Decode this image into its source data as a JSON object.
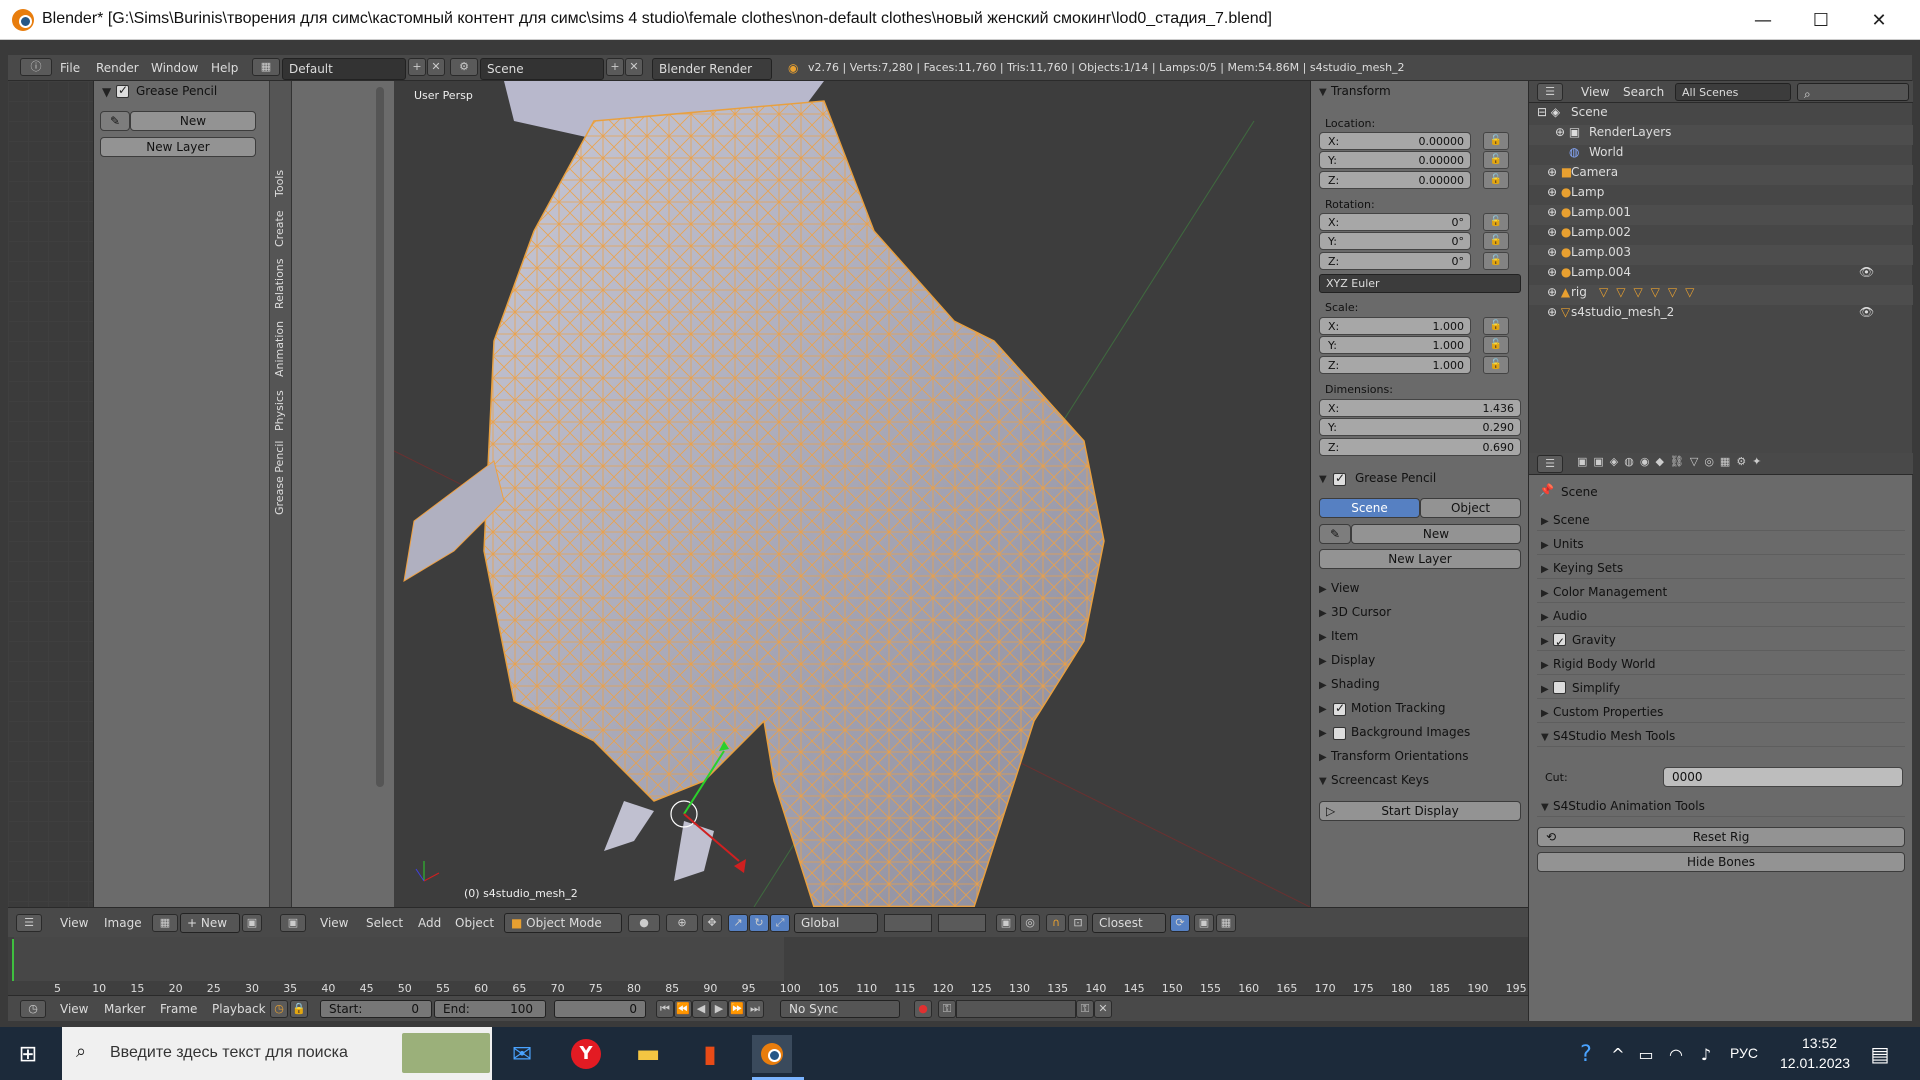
{
  "window": {
    "title": "Blender* [G:\\Sims\\Burinis\\творения для симс\\кастомный контент для симс\\sims 4 studio\\female clothes\\non-default clothes\\новый женский смокинг\\lod0_стадия_7.blend]",
    "minimize": "—",
    "maximize": "☐",
    "close": "✕"
  },
  "infobar": {
    "menus": [
      "File",
      "Render",
      "Window",
      "Help"
    ],
    "layout": "Default",
    "scene": "Scene",
    "engine": "Blender Render",
    "stats": "v2.76 | Verts:7,280 | Faces:11,760 | Tris:11,760 | Objects:1/14 | Lamps:0/5 | Mem:54.86M | s4studio_mesh_2"
  },
  "left_panel": {
    "title": "Grease Pencil",
    "new_button": "New",
    "new_layer_button": "New Layer"
  },
  "tool_tabs": [
    "Tools",
    "Create",
    "Relations",
    "Animation",
    "Physics",
    "Grease Pencil"
  ],
  "viewport": {
    "view_label": "User Persp",
    "object_label": "(0) s4studio_mesh_2"
  },
  "npanel": {
    "transform_title": "Transform",
    "location_label": "Location:",
    "location": {
      "x": "0.00000",
      "y": "0.00000",
      "z": "0.00000"
    },
    "rotation_label": "Rotation:",
    "rotation": {
      "x": "0°",
      "y": "0°",
      "z": "0°"
    },
    "rotation_mode": "XYZ Euler",
    "scale_label": "Scale:",
    "scale": {
      "x": "1.000",
      "y": "1.000",
      "z": "1.000"
    },
    "dimensions_label": "Dimensions:",
    "dimensions": {
      "x": "1.436",
      "y": "0.290",
      "z": "0.690"
    },
    "axis": {
      "x": "X:",
      "y": "Y:",
      "z": "Z:"
    },
    "grease_title": "Grease Pencil",
    "scene_tab": "Scene",
    "object_tab": "Object",
    "new_button": "New",
    "new_layer_button": "New Layer",
    "sections": [
      "View",
      "3D Cursor",
      "Item",
      "Display",
      "Shading",
      "Motion Tracking",
      "Background Images",
      "Transform Orientations",
      "Screencast Keys"
    ],
    "start_display": "Start Display"
  },
  "outliner": {
    "menus": [
      "View",
      "Search"
    ],
    "filter": "All Scenes",
    "rows": [
      "Scene",
      "RenderLayers",
      "World",
      "Camera",
      "Lamp",
      "Lamp.001",
      "Lamp.002",
      "Lamp.003",
      "Lamp.004",
      "rig",
      "s4studio_mesh_2"
    ]
  },
  "properties": {
    "context": "Scene",
    "sections": [
      "Scene",
      "Units",
      "Keying Sets",
      "Color Management",
      "Audio",
      "Gravity",
      "Rigid Body World",
      "Simplify",
      "Custom Properties"
    ],
    "mesh_tools_title": "S4Studio Mesh Tools",
    "cut_label": "Cut:",
    "cut_value": "0000",
    "anim_tools_title": "S4Studio Animation Tools",
    "reset_rig": "Reset Rig",
    "hide_bones": "Hide Bones"
  },
  "viewport_header": {
    "left_items": [
      "View",
      "Image",
      "New"
    ],
    "menus": [
      "View",
      "Select",
      "Add",
      "Object"
    ],
    "mode": "Object Mode",
    "orientation": "Global",
    "snap": "Closest"
  },
  "timeline": {
    "ticks": [
      "5",
      "10",
      "15",
      "20",
      "25",
      "30",
      "35",
      "40",
      "45",
      "50",
      "55",
      "60",
      "65",
      "70",
      "75",
      "80",
      "85",
      "90",
      "95",
      "100",
      "105",
      "110",
      "115",
      "120",
      "125",
      "130",
      "135",
      "140",
      "145",
      "150",
      "155",
      "160",
      "165",
      "170",
      "175",
      "180",
      "185",
      "190",
      "195"
    ],
    "menus": [
      "View",
      "Marker",
      "Frame",
      "Playback"
    ],
    "start_label": "Start:",
    "start_value": "0",
    "end_label": "End:",
    "end_value": "100",
    "current": "0",
    "sync": "No Sync"
  },
  "taskbar": {
    "search_placeholder": "Введите здесь текст для поиска",
    "lang": "РУС",
    "time": "13:52",
    "date": "12.01.2023"
  },
  "colors": {
    "wire": "#f0a040",
    "accent_blue": "#5680c2",
    "blender_orange": "#e87d0d"
  }
}
